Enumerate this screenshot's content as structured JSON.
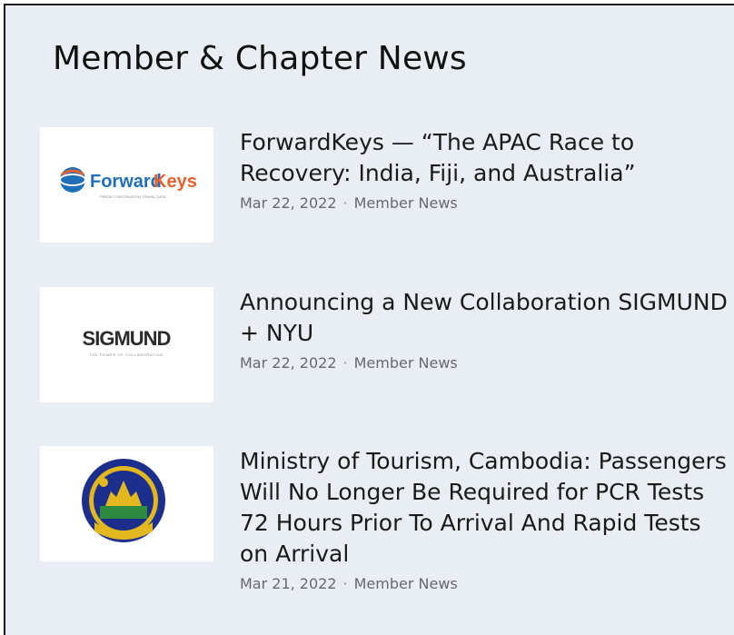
{
  "section": {
    "title": "Member & Chapter News"
  },
  "items": [
    {
      "title": "ForwardKeys — “The APAC Race to Recovery: India, Fiji, and Australia”",
      "date": "Mar 22, 2022",
      "separator": "·",
      "category": "Member News",
      "logo": {
        "icon": "forwardkeys-logo",
        "text_a": "Forward",
        "text_b": "Keys",
        "tagline": "PREDICT DESTINATION TRAVEL DATA",
        "color_a": "#1f6fb8",
        "color_b": "#e8612c"
      }
    },
    {
      "title": "Announcing a New Collaboration SIGMUND + NYU",
      "date": "Mar 22, 2022",
      "separator": "·",
      "category": "Member News",
      "logo": {
        "icon": "sigmund-logo",
        "text": "SIGMUND",
        "tagline": "THE POWER OF COLLABORATION",
        "color": "#2c2c2c"
      }
    },
    {
      "title": "Ministry of Tourism, Cambodia: Passengers Will No Longer Be Required for PCR Tests 72 Hours Prior To Arrival And Rapid Tests on Arrival",
      "date": "Mar 21, 2022",
      "separator": "·",
      "category": "Member News",
      "logo": {
        "icon": "ministry-of-tourism-cambodia-seal",
        "color_ring": "#1d2f8c",
        "color_gold": "#e3b81f",
        "color_green": "#2d8a3e"
      }
    }
  ]
}
